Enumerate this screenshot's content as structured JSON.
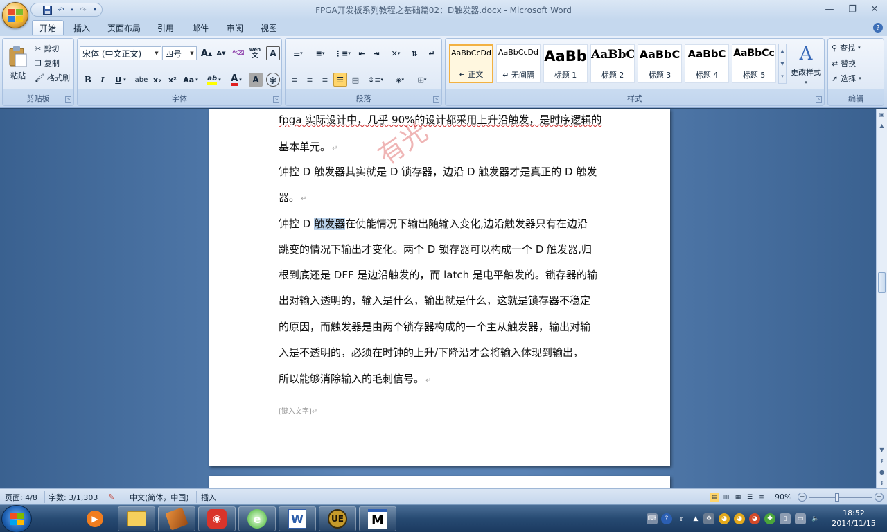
{
  "window": {
    "title": "FPGA开发板系列教程之基础篇02：D触发器.docx - Microsoft Word"
  },
  "qat": {
    "save": "save",
    "undo": "undo",
    "redo": "redo",
    "customize": "customize"
  },
  "tabs": [
    {
      "label": "开始",
      "active": true
    },
    {
      "label": "插入"
    },
    {
      "label": "页面布局"
    },
    {
      "label": "引用"
    },
    {
      "label": "邮件"
    },
    {
      "label": "审阅"
    },
    {
      "label": "视图"
    }
  ],
  "ribbon": {
    "clipboard": {
      "label": "剪贴板",
      "paste": "粘贴",
      "cut": "剪切",
      "copy": "复制",
      "format_painter": "格式刷"
    },
    "font": {
      "label": "字体",
      "font_name": "宋体 (中文正文)",
      "font_size": "四号",
      "bold": "B",
      "italic": "I",
      "underline": "U",
      "strike": "abe",
      "subscript": "x₂",
      "superscript": "x²",
      "change_case": "Aa",
      "grow": "A",
      "shrink": "A",
      "clear": "A",
      "phonetic": "wén",
      "border_char": "A",
      "highlight": "ab",
      "font_color": "A",
      "shading": "A",
      "enclose": "字"
    },
    "paragraph": {
      "label": "段落"
    },
    "styles": {
      "label": "样式",
      "change_styles": "更改样式",
      "items": [
        {
          "preview": "AaBbCcDd",
          "name": "↵ 正文"
        },
        {
          "preview": "AaBbCcDd",
          "name": "↵ 无间隔"
        },
        {
          "preview": "AaBb",
          "name": "标题 1"
        },
        {
          "preview": "AaBbC",
          "name": "标题 2"
        },
        {
          "preview": "AaBbC",
          "name": "标题 3"
        },
        {
          "preview": "AaBbC",
          "name": "标题 4"
        },
        {
          "preview": "AaBbCc",
          "name": "标题 5"
        }
      ]
    },
    "editing": {
      "label": "编辑",
      "find": "查找",
      "replace": "替换",
      "select": "选择"
    }
  },
  "document": {
    "watermark": "有光",
    "lines": [
      "fpga 实际设计中，几乎 90%的设计都采用上升沿触发，是时序逻辑的",
      "基本单元。",
      "钟控 D 触发器其实就是 D 锁存器，边沿 D 触发器才是真正的 D 触发",
      "器。",
      "钟控 D ",
      "跳变的情况下输出才变化。两个 D 锁存器可以构成一个 D 触发器,归",
      "根到底还是 DFF 是边沿触发的，而 latch 是电平触发的。锁存器的输",
      "出对输入透明的，输入是什么，输出就是什么，这就是锁存器不稳定",
      "的原因，而触发器是由两个锁存器构成的一个主从触发器，输出对输",
      "入是不透明的，必须在时钟的上升/下降沿才会将输入体现到输出，",
      "所以能够消除输入的毛刺信号。"
    ],
    "selected": "触发器",
    "line5_rest": "在使能情况下输出随输入变化,边沿触发器只有在边沿",
    "para_mark": "↵",
    "header_placeholder": "[键入文字]"
  },
  "status": {
    "page": "页面: 4/8",
    "words": "字数: 3/1,303",
    "language": "中文(简体，中国)",
    "mode": "插入",
    "zoom": "90%"
  },
  "taskbar": {
    "time": "18:52",
    "date": "2014/11/15"
  }
}
